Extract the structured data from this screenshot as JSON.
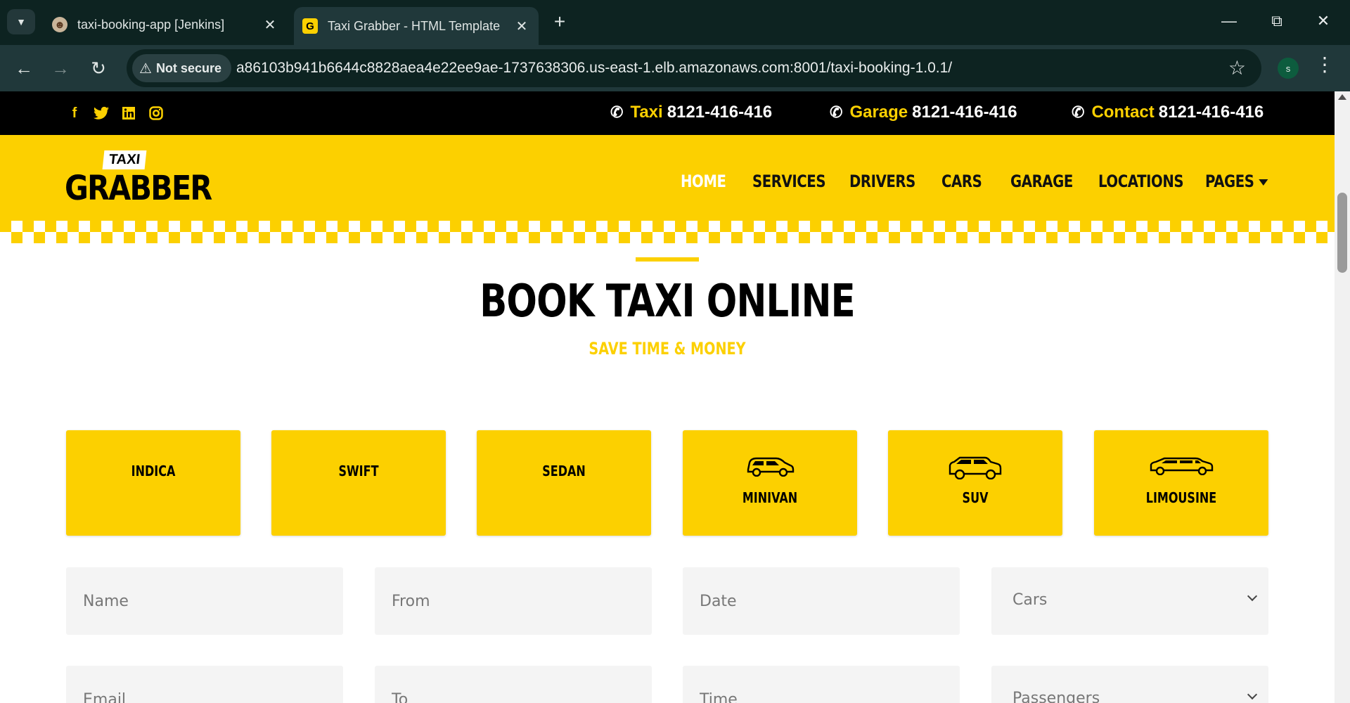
{
  "browser": {
    "tabs": [
      {
        "title": "taxi-booking-app [Jenkins]",
        "active": false
      },
      {
        "title": "Taxi Grabber - HTML Template",
        "active": true,
        "favicon_letter": "G"
      }
    ],
    "security_label": "Not secure",
    "url": "a86103b941b6644c8828aea4e22ee9ae-1737638306.us-east-1.elb.amazonaws.com:8001/taxi-booking-1.0.1/",
    "profile_initial": "s"
  },
  "topbar": {
    "social": [
      "f",
      "t",
      "in",
      "ig"
    ],
    "contacts": [
      {
        "label": "Taxi",
        "number": "8121-416-416"
      },
      {
        "label": "Garage",
        "number": "8121-416-416"
      },
      {
        "label": "Contact",
        "number": "8121-416-416"
      }
    ]
  },
  "header": {
    "logo_top": "TAXI",
    "logo_main": "GRABBER",
    "nav": [
      "HOME",
      "SERVICES",
      "DRIVERS",
      "CARS",
      "GARAGE",
      "LOCATIONS",
      "PAGES"
    ],
    "active_nav": "HOME"
  },
  "booking": {
    "title": "BOOK TAXI ONLINE",
    "subtitle": "SAVE TIME & MONEY",
    "car_types": [
      "INDICA",
      "SWIFT",
      "SEDAN",
      "MINIVAN",
      "SUV",
      "LIMOUSINE"
    ],
    "fields": {
      "name": "Name",
      "from": "From",
      "date": "Date",
      "cars": "Cars",
      "email": "Email",
      "to": "To",
      "time": "Time",
      "passengers": "Passengers"
    }
  },
  "colors": {
    "accent": "#fcd000",
    "topbar": "#000000",
    "chrome_dark": "#0d2321",
    "chrome_bar": "#20383a"
  }
}
